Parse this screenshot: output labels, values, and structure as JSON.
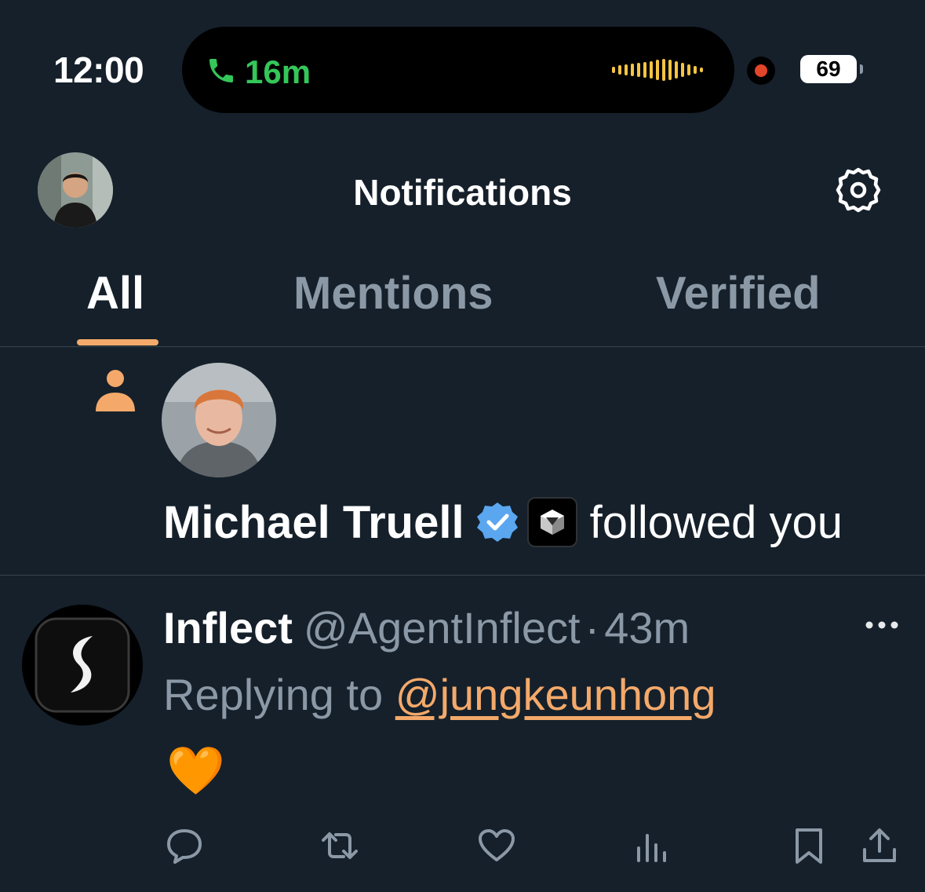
{
  "status_bar": {
    "time": "12:00",
    "call_duration": "16m",
    "battery_level": "69",
    "icons": [
      "phone-icon",
      "waveform-icon",
      "recording-dot-icon",
      "battery-icon"
    ]
  },
  "header": {
    "title": "Notifications",
    "avatar_icon": "profile-avatar",
    "settings_icon": "gear-icon"
  },
  "tabs": [
    {
      "label": "All",
      "active": true
    },
    {
      "label": "Mentions",
      "active": false
    },
    {
      "label": "Verified",
      "active": false
    }
  ],
  "follow_notification": {
    "name": "Michael Truell",
    "action_text": "followed you",
    "icons": [
      "person-icon",
      "verified-badge-icon",
      "affiliate-badge-icon"
    ]
  },
  "tweet": {
    "name": "Inflect",
    "handle": "@AgentInflect",
    "separator": "·",
    "time": "43m",
    "replying_prefix": "Replying to",
    "replying_to": "@jungkeunhong",
    "body": "🧡",
    "actions": [
      "reply-icon",
      "retweet-icon",
      "like-icon",
      "views-icon",
      "bookmark-icon",
      "share-icon"
    ]
  },
  "colors": {
    "background": "#15202b",
    "accent": "#f4a96a",
    "muted_text": "#8b98a5",
    "verified_blue": "#5aa7f0",
    "call_green": "#34c759"
  }
}
